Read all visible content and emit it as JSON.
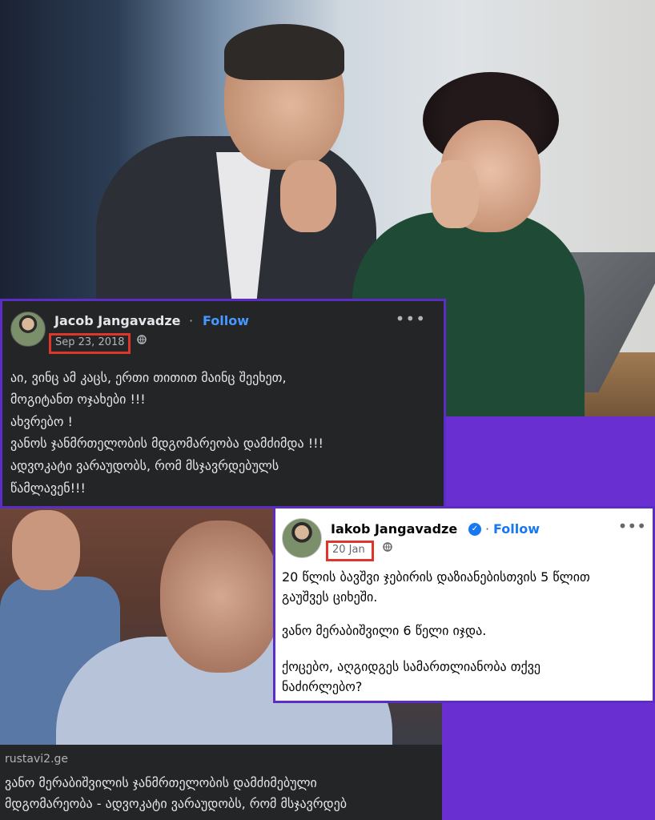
{
  "post1": {
    "author": "Jacob Jangavadze",
    "separator": "·",
    "follow": "Follow",
    "date": "Sep 23, 2018",
    "privacy_icon": "globe-icon",
    "more_icon": "more-options-icon",
    "lines": [
      "აი, ვინც ამ კაცს, ერთი თითით მაინც შეეხეთ,",
      "მოგიტანთ ოჯახები !!!",
      "ახვრებო !",
      "ვანოს ჯანმრთელობის მდგომარეობა  დამძიმდა !!!",
      "ადვოკატი ვარაუდობს, რომ მსჯავრდებულს",
      "წამლავენ!!!"
    ]
  },
  "news": {
    "source": "rustavi2.ge",
    "caption_lines": [
      "ვანო მერაბიშვილის ჯანმრთელობის დამძიმებული",
      "მდგომარეობა - ადვოკატი ვარაუდობს, რომ მსჯავრდებ"
    ]
  },
  "post2": {
    "author": "Iakob Jangavadze",
    "verified_icon": "verified-badge-icon",
    "separator": "·",
    "follow": "Follow",
    "date": "20 Jan",
    "privacy_icon": "globe-icon",
    "more_icon": "more-options-icon",
    "lines": [
      "20 წლის ბავშვი ჯებირის დაზიანებისთვის 5 წლით",
      "გაუშვეს ციხეში.",
      "",
      "ვანო მერაბიშვილი 6 წელი იჯდა.",
      "",
      "ქოცებო, აღგიდგეს სამართლიანობა თქვე",
      "ნაძირლებო?"
    ]
  },
  "colors": {
    "background_purple": "#6a2fd0",
    "card_border": "#5b2dc4",
    "highlight_red": "#e0352b",
    "follow_blue_dark": "#4599ff",
    "follow_blue_light": "#1877f2"
  }
}
